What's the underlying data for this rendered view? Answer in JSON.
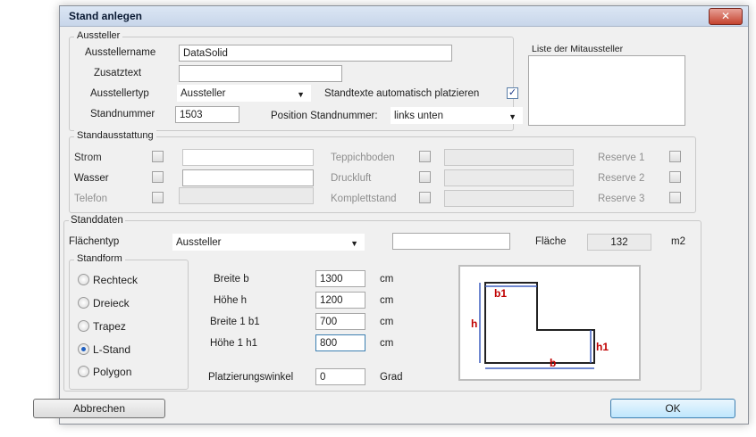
{
  "window": {
    "title": "Stand anlegen",
    "close_glyph": "✕"
  },
  "aussteller": {
    "group_label": "Aussteller",
    "name_label": "Ausstellername",
    "name_value": "DataSolid",
    "zusatz_label": "Zusatztext",
    "zusatz_value": "",
    "typ_label": "Ausstellertyp",
    "typ_value": "Aussteller",
    "auto_label": "Standtexte automatisch platzieren",
    "auto_checked": true,
    "standnr_label": "Standnummer",
    "standnr_value": "1503",
    "pos_label": "Position Standnummer:",
    "pos_value": "links unten",
    "list_label": "Liste der Mitaussteller"
  },
  "ausstattung": {
    "group_label": "Standausstattung",
    "left": [
      "Strom",
      "Wasser",
      "Telefon"
    ],
    "middle": [
      "Teppichboden",
      "Druckluft",
      "Komplettstand"
    ],
    "right": [
      "Reserve 1",
      "Reserve 2",
      "Reserve 3"
    ]
  },
  "standdaten": {
    "group_label": "Standdaten",
    "flaechentyp_label": "Flächentyp",
    "flaechentyp_value": "Aussteller",
    "flaeche_label": "Fläche",
    "flaeche_value": "132",
    "flaeche_unit": "m2",
    "standform_label": "Standform",
    "forms": [
      "Rechteck",
      "Dreieck",
      "Trapez",
      "L-Stand",
      "Polygon"
    ],
    "selected_form": "L-Stand",
    "dims": [
      {
        "label": "Breite b",
        "value": "1300",
        "unit": "cm"
      },
      {
        "label": "Höhe h",
        "value": "1200",
        "unit": "cm"
      },
      {
        "label": "Breite 1 b1",
        "value": "700",
        "unit": "cm"
      },
      {
        "label": "Höhe 1 h1",
        "value": "800",
        "unit": "cm"
      }
    ],
    "winkel_label": "Platzierungswinkel",
    "winkel_value": "0",
    "winkel_unit": "Grad",
    "diagram": {
      "b": "b",
      "h": "h",
      "b1": "b1",
      "h1": "h1"
    }
  },
  "buttons": {
    "cancel": "Abbrechen",
    "ok": "OK"
  },
  "colors": {
    "dim_label": "#c00000",
    "dim_line": "#4060c0",
    "shape": "#222222"
  }
}
